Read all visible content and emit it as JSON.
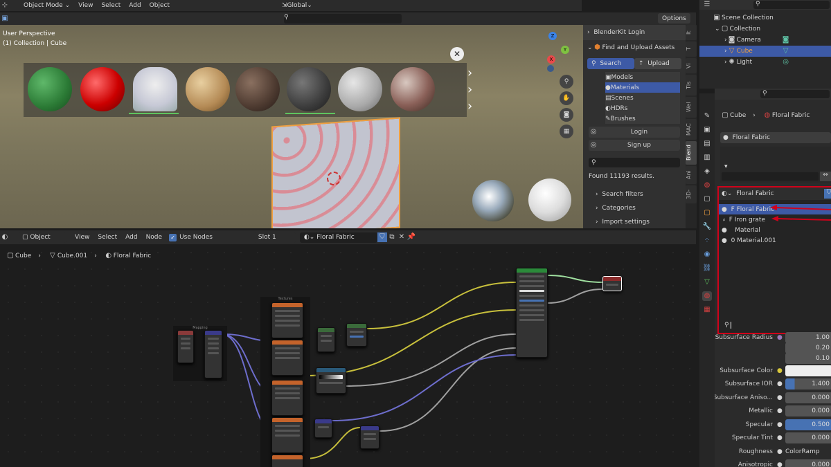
{
  "topbar": {
    "mode": "Object Mode",
    "menus": [
      "View",
      "Select",
      "Add",
      "Object"
    ],
    "transform": "Global"
  },
  "viewport": {
    "header_options": "Options",
    "label1": "User Perspective",
    "label2": "(1) Collection | Cube"
  },
  "blenderkit": {
    "login_header": "BlenderKit Login",
    "find_header": "Find and Upload Assets",
    "tab_search": "Search",
    "tab_upload": "Upload",
    "categories": [
      "Models",
      "Materials",
      "Scenes",
      "HDRs",
      "Brushes"
    ],
    "login": "Login",
    "signup": "Sign up",
    "results": "Found 11193 results.",
    "search_filters": "Search filters",
    "cat_label": "Categories",
    "import": "Import settings"
  },
  "sidetabs": [
    "Ani",
    "Blend",
    "3D-",
    "MAC",
    "Wel",
    "Tls",
    "Vi",
    "T",
    "It"
  ],
  "outliner": {
    "scene": "Scene Collection",
    "collection": "Collection",
    "items": [
      "Camera",
      "Cube",
      "Light"
    ]
  },
  "node_editor": {
    "type": "Object",
    "menus": [
      "View",
      "Select",
      "Add",
      "Node"
    ],
    "use_nodes": "Use Nodes",
    "slot": "Slot 1",
    "material": "Floral Fabric",
    "breadcrumb": [
      "Cube",
      "Cube.001",
      "Floral Fabric"
    ],
    "node_titles": [
      "Mapping",
      "Textures"
    ]
  },
  "props": {
    "breadcrumb_obj": "Cube",
    "breadcrumb_mat": "Floral Fabric",
    "mat_slot": "Floral Fabric",
    "dropdown_header": "Floral Fabric",
    "dropdown_items": [
      "F Floral Fabric",
      "F Iron grate",
      "Material",
      "0 Material.001"
    ],
    "rows": [
      {
        "label": "Subsurface Radius",
        "value": "1.00"
      },
      {
        "label": "",
        "value": "0.20"
      },
      {
        "label": "",
        "value": "0.10"
      },
      {
        "label": "Subsurface Color",
        "value": ""
      },
      {
        "label": "Subsurface IOR",
        "value": "1.400"
      },
      {
        "label": "Subsurface Aniso...",
        "value": "0.000"
      },
      {
        "label": "Metallic",
        "value": "0.000"
      },
      {
        "label": "Specular",
        "value": "0.500"
      },
      {
        "label": "Specular Tint",
        "value": "0.000"
      },
      {
        "label": "Roughness",
        "value": "ColorRamp"
      },
      {
        "label": "Anisotropic",
        "value": "0.000"
      }
    ]
  },
  "colors": {
    "accent": "#4772b3",
    "highlight_red": "#d0021b",
    "selected": "#3d5aa6"
  }
}
